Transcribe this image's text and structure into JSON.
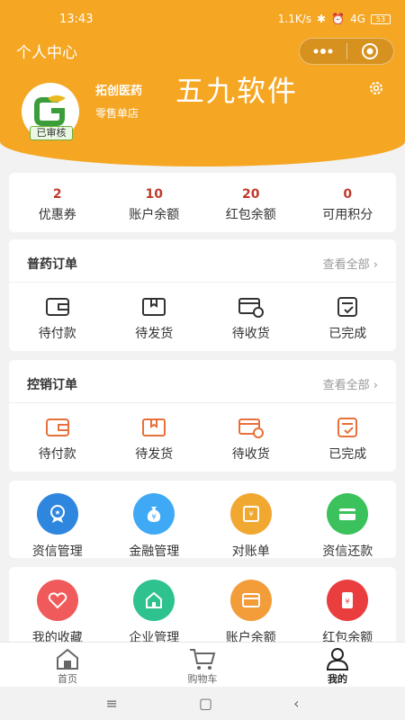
{
  "status": {
    "time": "13:43",
    "network": "1.1K/s",
    "signal": "4G",
    "battery": "53"
  },
  "header": {
    "title": "个人中心",
    "company_name": "拓创医药",
    "company_type": "零售单店",
    "verified_badge": "已审核",
    "watermark": "五九软件"
  },
  "stats": [
    {
      "value": "2",
      "label": "优惠券"
    },
    {
      "value": "10",
      "label": "账户余额"
    },
    {
      "value": "20",
      "label": "红包余额"
    },
    {
      "value": "0",
      "label": "可用积分"
    }
  ],
  "orders_general": {
    "title": "普药订单",
    "view_all": "查看全部",
    "items": [
      {
        "label": "待付款",
        "icon": "wallet-icon"
      },
      {
        "label": "待发货",
        "icon": "box-icon"
      },
      {
        "label": "待收货",
        "icon": "truck-icon"
      },
      {
        "label": "已完成",
        "icon": "done-icon"
      }
    ]
  },
  "orders_controlled": {
    "title": "控销订单",
    "view_all": "查看全部",
    "items": [
      {
        "label": "待付款",
        "icon": "wallet-icon"
      },
      {
        "label": "待发货",
        "icon": "box-icon"
      },
      {
        "label": "待收货",
        "icon": "truck-icon"
      },
      {
        "label": "已完成",
        "icon": "done-icon"
      }
    ]
  },
  "services_row1": [
    {
      "label": "资信管理",
      "icon": "credit-icon",
      "color": "#2e86de"
    },
    {
      "label": "金融管理",
      "icon": "moneybag-icon",
      "color": "#3fa9f5"
    },
    {
      "label": "对账单",
      "icon": "statement-icon",
      "color": "#f0a830"
    },
    {
      "label": "资信还款",
      "icon": "card-icon",
      "color": "#3cc25c"
    }
  ],
  "services_row2": [
    {
      "label": "我的收藏",
      "icon": "heart-icon",
      "color": "#f15a5a"
    },
    {
      "label": "企业管理",
      "icon": "house-icon",
      "color": "#2ec28e"
    },
    {
      "label": "账户余额",
      "icon": "wallet-icon",
      "color": "#f39c3a"
    },
    {
      "label": "红包余额",
      "icon": "redpacket-icon",
      "color": "#ea3d3d"
    }
  ],
  "tabs": [
    {
      "label": "首页",
      "icon": "home-icon"
    },
    {
      "label": "购物车",
      "icon": "cart-icon"
    },
    {
      "label": "我的",
      "icon": "user-icon"
    }
  ],
  "colors": {
    "brand": "#f5a623",
    "stat_number": "#c0392b",
    "controlled_icon": "#e8703a"
  }
}
